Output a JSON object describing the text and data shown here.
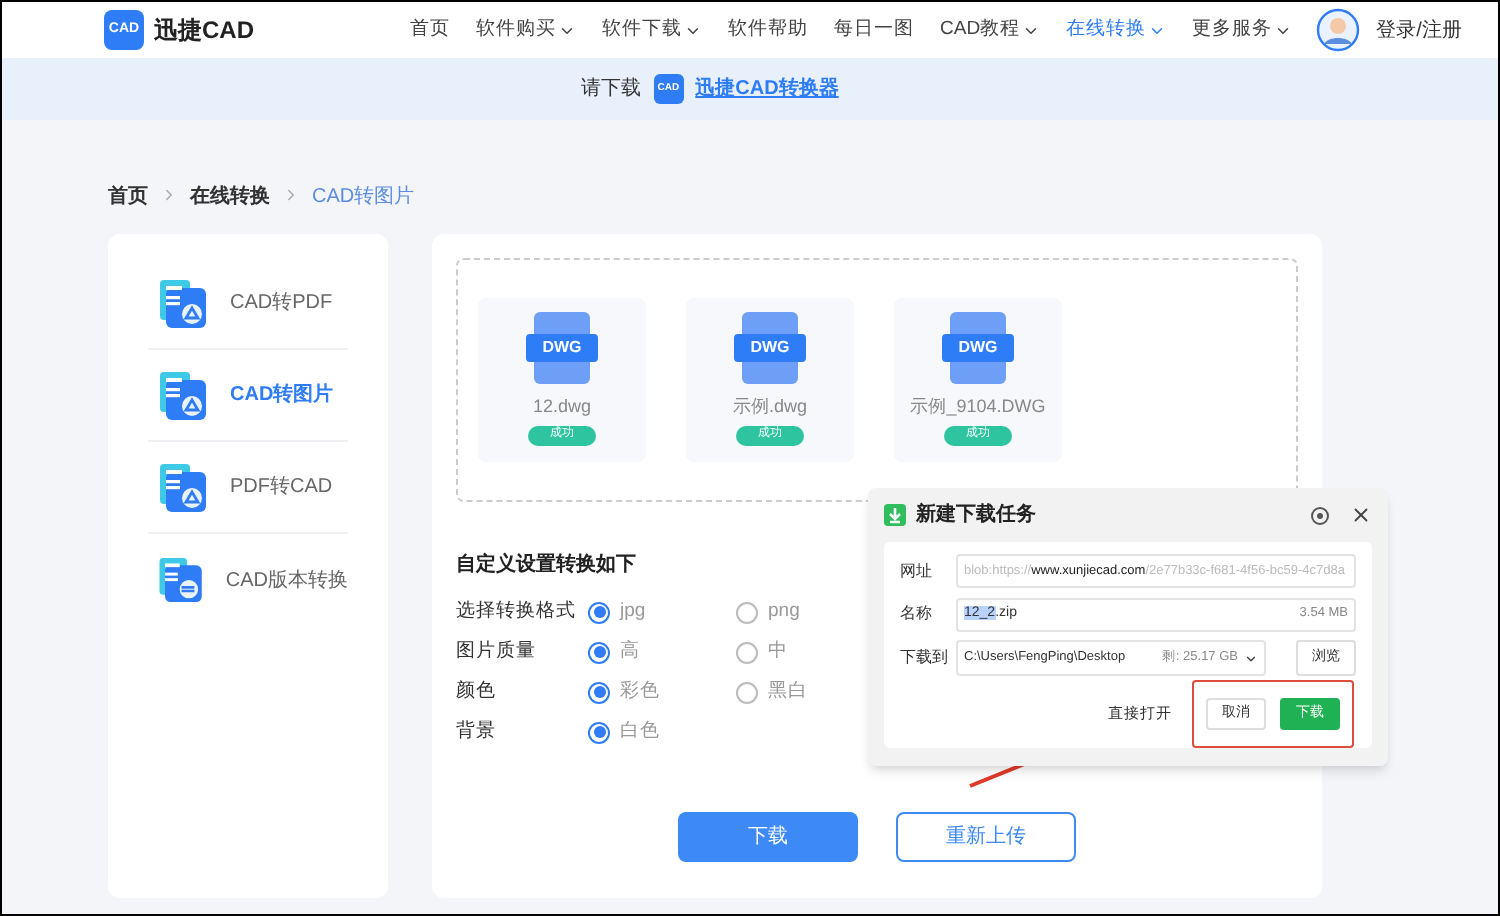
{
  "nav": {
    "logo_badge": "CAD",
    "brand": "迅捷CAD",
    "items": [
      {
        "label": "首页",
        "dropdown": false,
        "selected": false
      },
      {
        "label": "软件购买",
        "dropdown": true,
        "selected": false
      },
      {
        "label": "软件下载",
        "dropdown": true,
        "selected": false
      },
      {
        "label": "软件帮助",
        "dropdown": false,
        "selected": false
      },
      {
        "label": "每日一图",
        "dropdown": false,
        "selected": false
      },
      {
        "label": "CAD教程",
        "dropdown": true,
        "selected": false
      },
      {
        "label": "在线转换",
        "dropdown": true,
        "selected": true
      },
      {
        "label": "更多服务",
        "dropdown": true,
        "selected": false
      }
    ],
    "login": "登录/注册"
  },
  "banner": {
    "prompt": "请下载",
    "app_badge": "CAD",
    "link": "迅捷CAD转换器"
  },
  "breadcrumb": [
    {
      "label": "首页",
      "selected": false
    },
    {
      "label": "在线转换",
      "selected": false
    },
    {
      "label": "CAD转图片",
      "selected": true
    }
  ],
  "sidebar": {
    "items": [
      {
        "label": "CAD转PDF",
        "selected": false
      },
      {
        "label": "CAD转图片",
        "selected": true
      },
      {
        "label": "PDF转CAD",
        "selected": false
      },
      {
        "label": "CAD版本转换",
        "selected": false
      }
    ]
  },
  "files": [
    {
      "badge": "DWG",
      "name": "12.dwg",
      "status": "成功"
    },
    {
      "badge": "DWG",
      "name": "示例.dwg",
      "status": "成功"
    },
    {
      "badge": "DWG",
      "name": "示例_9104.DWG",
      "status": "成功"
    }
  ],
  "settings": {
    "title": "自定义设置转换如下",
    "rows": [
      {
        "label": "选择转换格式",
        "options": [
          {
            "label": "jpg",
            "selected": true
          },
          {
            "label": "png",
            "selected": false
          }
        ]
      },
      {
        "label": "图片质量",
        "options": [
          {
            "label": "高",
            "selected": true
          },
          {
            "label": "中",
            "selected": false
          }
        ]
      },
      {
        "label": "颜色",
        "options": [
          {
            "label": "彩色",
            "selected": true
          },
          {
            "label": "黑白",
            "selected": false
          }
        ]
      },
      {
        "label": "背景",
        "options": [
          {
            "label": "白色",
            "selected": true
          }
        ]
      }
    ]
  },
  "actions": [
    {
      "label": "下载",
      "kind": "primary"
    },
    {
      "label": "重新上传",
      "kind": "secondary"
    }
  ],
  "dialog": {
    "title": "新建下载任务",
    "url": {
      "label": "网址",
      "parts": [
        {
          "text": "blob:https://",
          "strong": false
        },
        {
          "text": "www.xunjiecad.com",
          "strong": true
        },
        {
          "text": "/2e77b33c-f681-4f56-bc59-4c7d8a",
          "strong": false
        }
      ]
    },
    "name": {
      "label": "名称",
      "selected_text": "12_2",
      "rest": ".zip",
      "size": "3.54 MB"
    },
    "save_to": {
      "label": "下载到",
      "path": "C:\\Users\\FengPing\\Desktop",
      "free": "剩: 25.17 GB",
      "browse": "浏览"
    },
    "open_direct": "直接打开",
    "cancel": "取消",
    "download": "下载"
  }
}
